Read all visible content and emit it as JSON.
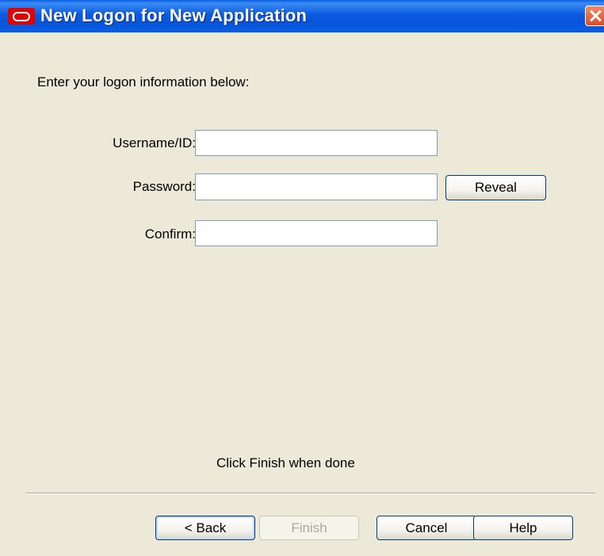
{
  "window": {
    "title": "New Logon for New Application"
  },
  "instructions": "Enter your logon information below:",
  "form": {
    "username_label": "Username/ID:",
    "username_value": "",
    "password_label": "Password:",
    "password_value": "",
    "reveal_button": "Reveal",
    "confirm_label": "Confirm:",
    "confirm_value": ""
  },
  "footer_hint": "Click Finish when done",
  "buttons": {
    "back": "< Back",
    "finish": "Finish",
    "cancel": "Cancel",
    "help": "Help"
  },
  "colors": {
    "titlebar": "#0b5ae0",
    "dialog_bg": "#ece9d8",
    "close_button": "#d94c24",
    "oracle_logo": "#e30000",
    "field_border": "#7f9db9",
    "button_border": "#003c74"
  }
}
